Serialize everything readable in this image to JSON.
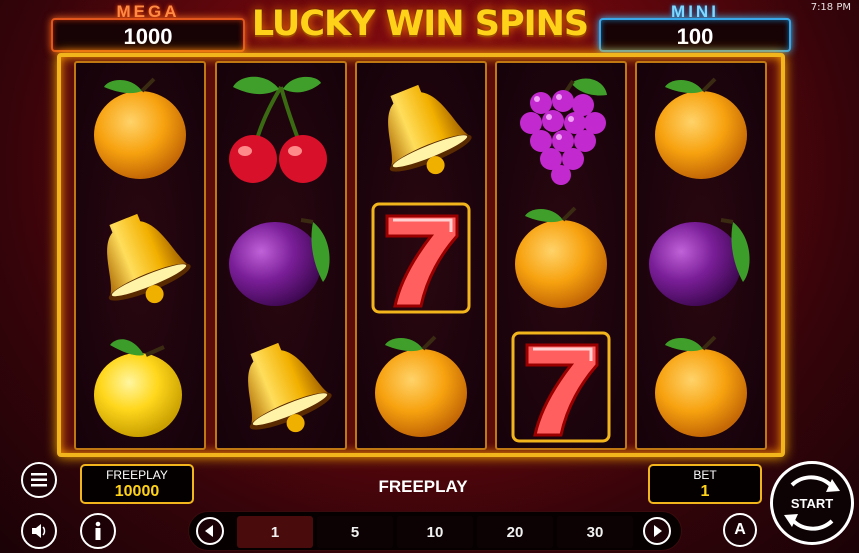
{
  "status_bar": {
    "time": "7:18 PM"
  },
  "game_title": "LUCKY WIN SPINS",
  "jackpots": {
    "mega": {
      "label": "MEGA",
      "value": "1000"
    },
    "mini": {
      "label": "MINI",
      "value": "100"
    }
  },
  "reels": [
    [
      "orange",
      "bell",
      "lemon"
    ],
    [
      "cherry",
      "plum",
      "bell"
    ],
    [
      "bell",
      "seven",
      "orange"
    ],
    [
      "grapes",
      "orange",
      "seven"
    ],
    [
      "orange",
      "plum",
      "orange"
    ]
  ],
  "bottom": {
    "freeplay_label": "FREEPLAY",
    "freeplay_value": "10000",
    "center_text": "FREEPLAY",
    "bet_label": "BET",
    "bet_value": "1",
    "start_label": "START",
    "auto_label": "A",
    "bet_options": [
      "1",
      "5",
      "10",
      "20",
      "30"
    ],
    "selected_bet": "1"
  },
  "colors": {
    "gold": "#f2b51c",
    "mega_glow": "#ff6a1c",
    "mini_glow": "#3ec1ff",
    "value_yellow": "#ffd21a"
  },
  "icons": [
    "menu-icon",
    "sound-icon",
    "info-icon",
    "arrow-left-icon",
    "arrow-right-icon",
    "autoplay-icon",
    "start-icon"
  ]
}
